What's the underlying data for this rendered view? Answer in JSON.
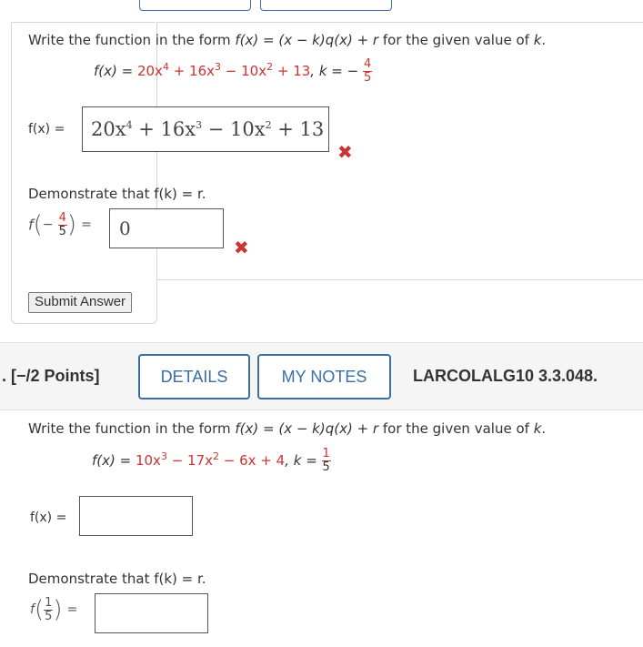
{
  "q1": {
    "instruction_prefix": "Write the function in the form ",
    "instruction_form": "f(x) = (x − k)q(x) + r",
    "instruction_mid": " for the given value of ",
    "instruction_k": "k",
    "instruction_end": ".",
    "func_label": "f(x) = ",
    "func_expr": "20x4 + 16x3 − 10x2 + 13",
    "func_terms": [
      "20x",
      "4",
      " + 16x",
      "3",
      " − 10x",
      "2",
      " + 13"
    ],
    "k_label": ", k = −",
    "k_num": "4",
    "k_den": "5",
    "answer_label": "f(x) =",
    "answer_terms": [
      "20x",
      "4",
      " + 16x",
      "3",
      " − 10x",
      "2",
      " + 13"
    ],
    "answer_status": "incorrect",
    "demonstrate_text": "Demonstrate that f(k) = r.",
    "fk_f": "f",
    "fk_sign": "−",
    "fk_num": "4",
    "fk_den": "5",
    "fk_equals": "=",
    "fk_value": "0",
    "fk_status": "incorrect",
    "submit_label": "Submit Answer"
  },
  "q2": {
    "points_label": ". [−/2 Points]",
    "details_label": "DETAILS",
    "notes_label": "MY NOTES",
    "code": "LARCOLALG10 3.3.048.",
    "instruction_prefix": "Write the function in the form ",
    "instruction_form": "f(x) = (x − k)q(x) + r",
    "instruction_mid": " for the given value of ",
    "instruction_k": "k",
    "instruction_end": ".",
    "func_label": "f(x) = ",
    "func_terms": [
      "10x",
      "3",
      " − 17x",
      "2",
      " − 6x + 4"
    ],
    "k_label": ", k = ",
    "k_num": "1",
    "k_den": "5",
    "answer_label": "f(x) =",
    "answer_value": "",
    "demonstrate_text": "Demonstrate that f(k) = r.",
    "fk_f": "f",
    "fk_num": "1",
    "fk_den": "5",
    "fk_equals": "=",
    "fk_value": ""
  },
  "colors": {
    "accent": "#3a6ea5",
    "error": "#cc3333",
    "math_red": "#cc3333"
  },
  "icons": {
    "incorrect": "x-mark-icon"
  }
}
